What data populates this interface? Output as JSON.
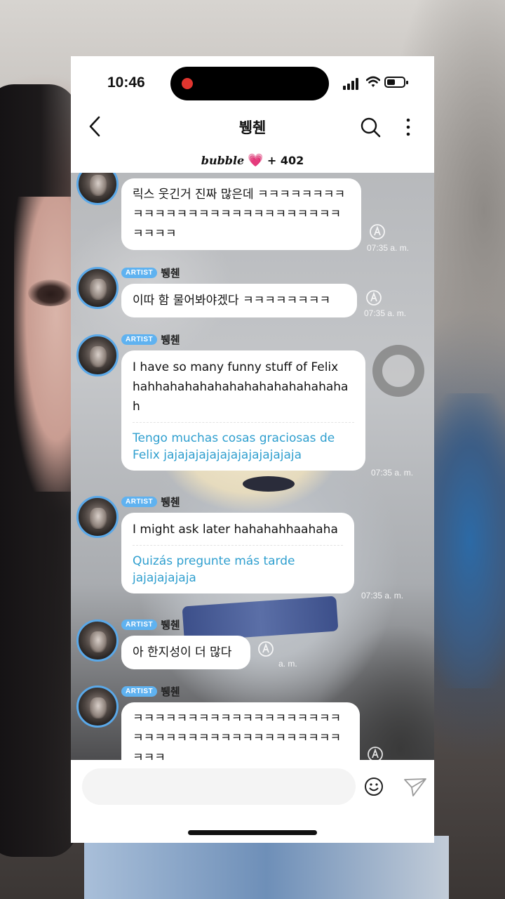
{
  "status_bar": {
    "time": "10:46",
    "icons": [
      "signal-icon",
      "wifi-icon",
      "battery-icon"
    ]
  },
  "header": {
    "title": "뷍췐",
    "back_icon": "chevron-left-icon",
    "search_icon": "search-icon",
    "more_icon": "more-vertical-icon",
    "brand": "bubble",
    "heart": "💗",
    "count": "+ 402"
  },
  "messages": [
    {
      "badge": "",
      "sender": "",
      "text": "릭스 웃긴거 진짜 많은데 ㅋㅋㅋㅋㅋㅋㅋㅋㅋㅋㅋㅋㅋㅋㅋㅋㅋㅋㅋㅋㅋㅋㅋㅋㅋㅋㅋㅋㅋㅋㅋ",
      "translation": "",
      "time": "07:35 a. m."
    },
    {
      "badge": "ARTIST",
      "sender": "뷍췐",
      "text": "이따 함 물어봐야겠다 ㅋㅋㅋㅋㅋㅋㅋㅋ",
      "translation": "",
      "time": "07:35 a. m."
    },
    {
      "badge": "ARTIST",
      "sender": "뷍췐",
      "text": "I have so many funny stuff of Felix hahhahahahahahahahahahahahaha h",
      "translation": "Tengo muchas cosas graciosas de Felix jajajajajajajajajajajajaja",
      "time": "07:35 a. m."
    },
    {
      "badge": "ARTIST",
      "sender": "뷍췐",
      "text": "I might ask later hahahahhaahaha",
      "translation": "Quizás pregunte más tarde jajajajajaja",
      "time": "07:35 a. m."
    },
    {
      "badge": "ARTIST",
      "sender": "뷍췐",
      "text": "아 한지성이 더 많다",
      "translation": "",
      "time": "a. m."
    },
    {
      "badge": "ARTIST",
      "sender": "뷍췐",
      "text": "ㅋㅋㅋㅋㅋㅋㅋㅋㅋㅋㅋㅋㅋㅋㅋㅋㅋㅋㅋㅋㅋㅋㅋㅋㅋㅋㅋㅋㅋㅋㅋㅋㅋㅋㅋㅋㅋㅋㅋㅋㅋ",
      "translation": "",
      "time": ""
    }
  ],
  "input": {
    "placeholder": "",
    "emoji_icon": "smiley-icon",
    "send_icon": "send-icon"
  }
}
